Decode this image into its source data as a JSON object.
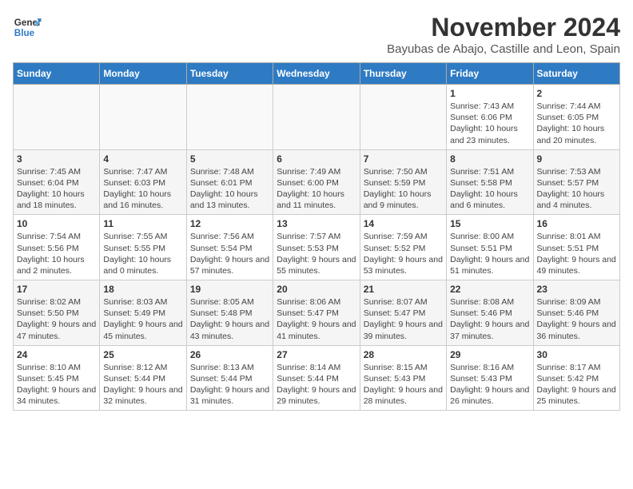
{
  "logo": {
    "line1": "General",
    "line2": "Blue"
  },
  "title": "November 2024",
  "location": "Bayubas de Abajo, Castille and Leon, Spain",
  "weekdays": [
    "Sunday",
    "Monday",
    "Tuesday",
    "Wednesday",
    "Thursday",
    "Friday",
    "Saturday"
  ],
  "weeks": [
    [
      {
        "day": "",
        "info": ""
      },
      {
        "day": "",
        "info": ""
      },
      {
        "day": "",
        "info": ""
      },
      {
        "day": "",
        "info": ""
      },
      {
        "day": "",
        "info": ""
      },
      {
        "day": "1",
        "info": "Sunrise: 7:43 AM\nSunset: 6:06 PM\nDaylight: 10 hours and 23 minutes."
      },
      {
        "day": "2",
        "info": "Sunrise: 7:44 AM\nSunset: 6:05 PM\nDaylight: 10 hours and 20 minutes."
      }
    ],
    [
      {
        "day": "3",
        "info": "Sunrise: 7:45 AM\nSunset: 6:04 PM\nDaylight: 10 hours and 18 minutes."
      },
      {
        "day": "4",
        "info": "Sunrise: 7:47 AM\nSunset: 6:03 PM\nDaylight: 10 hours and 16 minutes."
      },
      {
        "day": "5",
        "info": "Sunrise: 7:48 AM\nSunset: 6:01 PM\nDaylight: 10 hours and 13 minutes."
      },
      {
        "day": "6",
        "info": "Sunrise: 7:49 AM\nSunset: 6:00 PM\nDaylight: 10 hours and 11 minutes."
      },
      {
        "day": "7",
        "info": "Sunrise: 7:50 AM\nSunset: 5:59 PM\nDaylight: 10 hours and 9 minutes."
      },
      {
        "day": "8",
        "info": "Sunrise: 7:51 AM\nSunset: 5:58 PM\nDaylight: 10 hours and 6 minutes."
      },
      {
        "day": "9",
        "info": "Sunrise: 7:53 AM\nSunset: 5:57 PM\nDaylight: 10 hours and 4 minutes."
      }
    ],
    [
      {
        "day": "10",
        "info": "Sunrise: 7:54 AM\nSunset: 5:56 PM\nDaylight: 10 hours and 2 minutes."
      },
      {
        "day": "11",
        "info": "Sunrise: 7:55 AM\nSunset: 5:55 PM\nDaylight: 10 hours and 0 minutes."
      },
      {
        "day": "12",
        "info": "Sunrise: 7:56 AM\nSunset: 5:54 PM\nDaylight: 9 hours and 57 minutes."
      },
      {
        "day": "13",
        "info": "Sunrise: 7:57 AM\nSunset: 5:53 PM\nDaylight: 9 hours and 55 minutes."
      },
      {
        "day": "14",
        "info": "Sunrise: 7:59 AM\nSunset: 5:52 PM\nDaylight: 9 hours and 53 minutes."
      },
      {
        "day": "15",
        "info": "Sunrise: 8:00 AM\nSunset: 5:51 PM\nDaylight: 9 hours and 51 minutes."
      },
      {
        "day": "16",
        "info": "Sunrise: 8:01 AM\nSunset: 5:51 PM\nDaylight: 9 hours and 49 minutes."
      }
    ],
    [
      {
        "day": "17",
        "info": "Sunrise: 8:02 AM\nSunset: 5:50 PM\nDaylight: 9 hours and 47 minutes."
      },
      {
        "day": "18",
        "info": "Sunrise: 8:03 AM\nSunset: 5:49 PM\nDaylight: 9 hours and 45 minutes."
      },
      {
        "day": "19",
        "info": "Sunrise: 8:05 AM\nSunset: 5:48 PM\nDaylight: 9 hours and 43 minutes."
      },
      {
        "day": "20",
        "info": "Sunrise: 8:06 AM\nSunset: 5:47 PM\nDaylight: 9 hours and 41 minutes."
      },
      {
        "day": "21",
        "info": "Sunrise: 8:07 AM\nSunset: 5:47 PM\nDaylight: 9 hours and 39 minutes."
      },
      {
        "day": "22",
        "info": "Sunrise: 8:08 AM\nSunset: 5:46 PM\nDaylight: 9 hours and 37 minutes."
      },
      {
        "day": "23",
        "info": "Sunrise: 8:09 AM\nSunset: 5:46 PM\nDaylight: 9 hours and 36 minutes."
      }
    ],
    [
      {
        "day": "24",
        "info": "Sunrise: 8:10 AM\nSunset: 5:45 PM\nDaylight: 9 hours and 34 minutes."
      },
      {
        "day": "25",
        "info": "Sunrise: 8:12 AM\nSunset: 5:44 PM\nDaylight: 9 hours and 32 minutes."
      },
      {
        "day": "26",
        "info": "Sunrise: 8:13 AM\nSunset: 5:44 PM\nDaylight: 9 hours and 31 minutes."
      },
      {
        "day": "27",
        "info": "Sunrise: 8:14 AM\nSunset: 5:44 PM\nDaylight: 9 hours and 29 minutes."
      },
      {
        "day": "28",
        "info": "Sunrise: 8:15 AM\nSunset: 5:43 PM\nDaylight: 9 hours and 28 minutes."
      },
      {
        "day": "29",
        "info": "Sunrise: 8:16 AM\nSunset: 5:43 PM\nDaylight: 9 hours and 26 minutes."
      },
      {
        "day": "30",
        "info": "Sunrise: 8:17 AM\nSunset: 5:42 PM\nDaylight: 9 hours and 25 minutes."
      }
    ]
  ]
}
